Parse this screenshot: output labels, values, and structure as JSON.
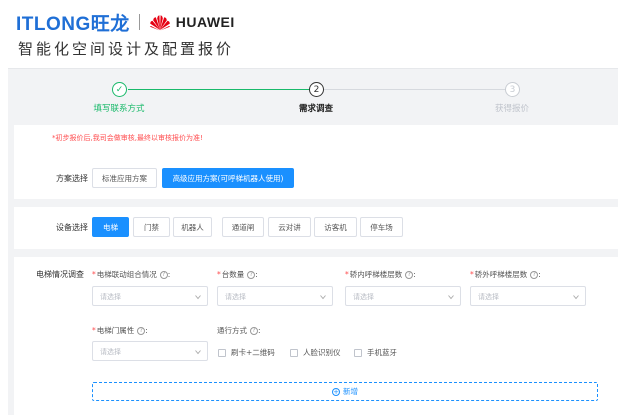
{
  "brand": {
    "itlong": "ITLONG旺龙",
    "huawei": "HUAWEI"
  },
  "page_title": "智能化空间设计及配置报价",
  "steps": [
    {
      "label": "填写联系方式",
      "marker": "✓",
      "state": "done"
    },
    {
      "label": "需求调查",
      "marker": "2",
      "state": "active"
    },
    {
      "label": "获得报价",
      "marker": "3",
      "state": "todo"
    }
  ],
  "notice": "*初步报价后,我司会做审核,最终以审核报价为准!",
  "plan": {
    "label": "方案选择",
    "options": [
      "标准应用方案",
      "高级应用方案(可呼梯机器人使用)"
    ],
    "selected": "高级应用方案(可呼梯机器人使用)"
  },
  "device": {
    "label": "设备选择",
    "options": [
      "电梯",
      "门禁",
      "机器人",
      "通道闸",
      "云对讲",
      "访客机",
      "停车场"
    ],
    "selected": "电梯"
  },
  "elevator": {
    "section_label": "电梯情况调查",
    "fields": [
      {
        "label": "电梯联动组合情况",
        "required": true,
        "placeholder": "请选择"
      },
      {
        "label": "台数量",
        "required": true,
        "placeholder": "请选择"
      },
      {
        "label": "轿内呼梯楼层数",
        "required": true,
        "placeholder": "请选择"
      },
      {
        "label": "轿外呼梯楼层数",
        "required": true,
        "placeholder": "请选择"
      }
    ],
    "door_field": {
      "label": "电梯门属性",
      "required": true,
      "placeholder": "请选择"
    },
    "pass_mode": {
      "label": "通行方式",
      "options": [
        "刷卡+二维码",
        "人脸识别仪",
        "手机蓝牙"
      ]
    },
    "add_label": "新增"
  },
  "colors": {
    "primary": "#1a90ff",
    "success": "#19b96a",
    "danger": "#ff4d4f",
    "brand_blue": "#1f6fd6",
    "huawei_red": "#e60012"
  }
}
